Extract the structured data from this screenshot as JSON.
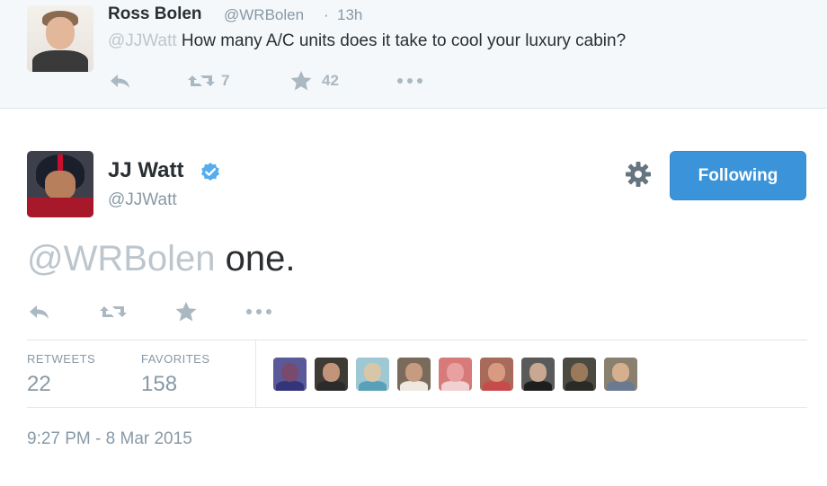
{
  "parent_tweet": {
    "name": "Ross Bolen",
    "handle": "@WRBolen",
    "separator": "·",
    "time": "13h",
    "mention": "@JJWatt",
    "text": " How many A/C units does it take to cool your luxury cabin?",
    "retweets": "7",
    "favorites": "42",
    "icons": [
      "reply-icon",
      "retweet-icon",
      "favorite-star-icon",
      "more-options-icon"
    ]
  },
  "main_tweet": {
    "name": "JJ Watt",
    "handle": "@JJWatt",
    "follow_label": "Following",
    "mention": "@WRBolen",
    "text": " one.",
    "icons": [
      "reply-icon",
      "retweet-icon",
      "favorite-star-icon",
      "more-options-icon",
      "gear-icon",
      "verified-badge-icon"
    ],
    "stats": {
      "retweets_label": "RETWEETS",
      "retweets_value": "22",
      "favorites_label": "FAVORITES",
      "favorites_value": "158"
    },
    "favorited_by_avatars": [
      {
        "head": "#7a4a6e",
        "body": "#34347a",
        "bg": "#5a5a9a"
      },
      {
        "head": "#c2957a",
        "body": "#2b2b2b",
        "bg": "#3e3a34"
      },
      {
        "head": "#d8c6a8",
        "body": "#5aa0b8",
        "bg": "#9ec8d4"
      },
      {
        "head": "#c79b80",
        "body": "#efe8e0",
        "bg": "#7a6a5c"
      },
      {
        "head": "#e8a0a0",
        "body": "#f0d0d0",
        "bg": "#d77a7a"
      },
      {
        "head": "#d89b82",
        "body": "#c84b4b",
        "bg": "#a86a5a"
      },
      {
        "head": "#c8a890",
        "body": "#1e1e1e",
        "bg": "#5a5a5a"
      },
      {
        "head": "#9a7a5a",
        "body": "#2a2a26",
        "bg": "#4a4a40"
      },
      {
        "head": "#d6b08e",
        "body": "#6a7a90",
        "bg": "#8a8070"
      }
    ],
    "timestamp": "9:27 PM - 8 Mar 2015"
  },
  "colors": {
    "accent_blue": "#3b94d9",
    "muted_text": "#8899a6",
    "mention_gray": "#bdc6cd",
    "icon_gray": "#aab8c2",
    "verified_blue": "#55acee"
  }
}
